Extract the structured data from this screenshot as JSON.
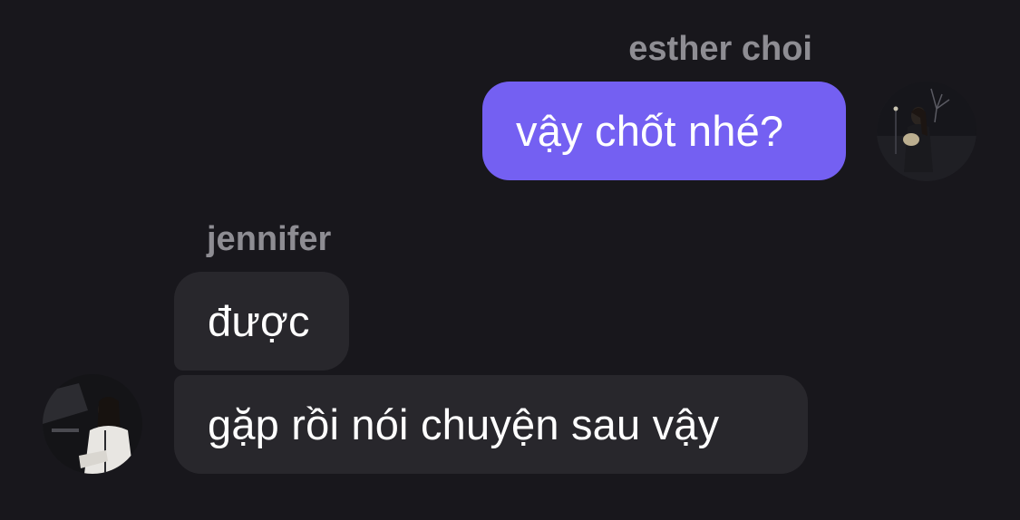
{
  "chat": {
    "messages_out": [
      {
        "sender": "esther choi",
        "text": "vậy chốt nhé?"
      }
    ],
    "messages_in": [
      {
        "sender": "jennifer",
        "texts": [
          "được",
          "gặp rồi nói chuyện sau vậy"
        ]
      }
    ]
  },
  "colors": {
    "background": "#18171c",
    "outgoing_bubble": "#7460f2",
    "incoming_bubble": "#28272c",
    "sender_name": "#8e8d93",
    "message_text": "#ffffff"
  },
  "avatars": {
    "esther": "avatar-photo-icon",
    "jennifer": "avatar-photo-icon"
  }
}
